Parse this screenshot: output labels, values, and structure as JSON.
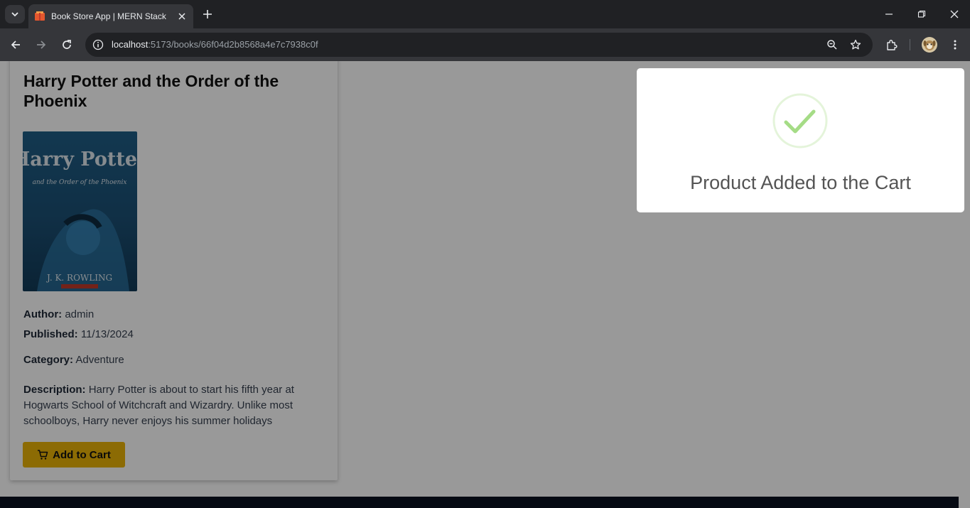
{
  "browser": {
    "tab_title": "Book Store App | MERN Stack Project",
    "url_host": "localhost",
    "url_path": ":5173/books/66f04d2b8568a4e7c7938c0f",
    "accent_color": "#202124"
  },
  "book": {
    "title": "Harry Potter and the Order of the Phoenix",
    "cover_icon": "book-cover-image",
    "cover_series_text": "Harry Potter",
    "cover_subtitle_text": "and the Order of the Phoenix",
    "cover_author_text": "J. K. ROWLING",
    "author_label": "Author:",
    "author_value": "admin",
    "published_label": "Published:",
    "published_value": "11/13/2024",
    "category_label": "Category:",
    "category_value": "Adventure",
    "description_label": "Description:",
    "description_value": "Harry Potter is about to start his fifth year at Hogwarts School of Witchcraft and Wizardry. Unlike most schoolboys, Harry never enjoys his summer holidays"
  },
  "actions": {
    "add_to_cart_label": "Add to Cart",
    "button_color": "#eab308"
  },
  "toast": {
    "message": "Product Added to the Cart",
    "icon": "success-check-icon",
    "icon_color": "#a5dc86"
  }
}
